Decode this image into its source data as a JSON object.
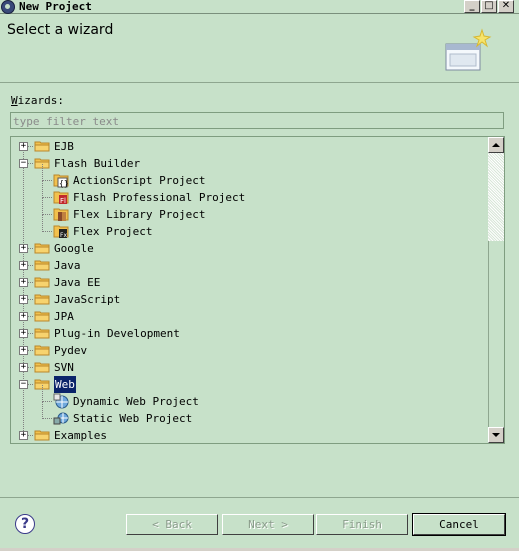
{
  "window": {
    "title": "New Project"
  },
  "header": {
    "heading": "Select a wizard"
  },
  "wizards": {
    "label_prefix": "",
    "label_mnemonic": "W",
    "label_rest": "izards:"
  },
  "filter": {
    "placeholder": "type filter text"
  },
  "tree": {
    "items": [
      {
        "label": "EJB",
        "level": 0,
        "expander": "+",
        "icon": "folder-icon"
      },
      {
        "label": "Flash Builder",
        "level": 0,
        "expander": "-",
        "icon": "folder-icon"
      },
      {
        "label": "ActionScript Project",
        "level": 1,
        "icon": "actionscript-project-icon"
      },
      {
        "label": "Flash Professional Project",
        "level": 1,
        "icon": "flash-professional-icon"
      },
      {
        "label": "Flex Library Project",
        "level": 1,
        "icon": "flex-library-icon"
      },
      {
        "label": "Flex Project",
        "level": 1,
        "icon": "flex-project-icon"
      },
      {
        "label": "Google",
        "level": 0,
        "expander": "+",
        "icon": "folder-icon"
      },
      {
        "label": "Java",
        "level": 0,
        "expander": "+",
        "icon": "folder-icon"
      },
      {
        "label": "Java EE",
        "level": 0,
        "expander": "+",
        "icon": "folder-icon"
      },
      {
        "label": "JavaScript",
        "level": 0,
        "expander": "+",
        "icon": "folder-icon"
      },
      {
        "label": "JPA",
        "level": 0,
        "expander": "+",
        "icon": "folder-icon"
      },
      {
        "label": "Plug-in Development",
        "level": 0,
        "expander": "+",
        "icon": "folder-icon"
      },
      {
        "label": "Pydev",
        "level": 0,
        "expander": "+",
        "icon": "folder-icon"
      },
      {
        "label": "SVN",
        "level": 0,
        "expander": "+",
        "icon": "folder-icon"
      },
      {
        "label": "Web",
        "level": 0,
        "expander": "-",
        "icon": "folder-icon",
        "selected": true
      },
      {
        "label": "Dynamic Web Project",
        "level": 1,
        "icon": "dynamic-web-project-icon"
      },
      {
        "label": "Static Web Project",
        "level": 1,
        "icon": "static-web-project-icon"
      },
      {
        "label": "Examples",
        "level": 0,
        "expander": "+",
        "icon": "folder-icon"
      }
    ]
  },
  "buttons": {
    "back": "< Back",
    "next": "Next >",
    "finish": "Finish",
    "cancel": "Cancel",
    "help": "?"
  },
  "colors": {
    "background": "#c7e1c9",
    "selection": "#0a246a",
    "folder": "#e8b84a"
  }
}
